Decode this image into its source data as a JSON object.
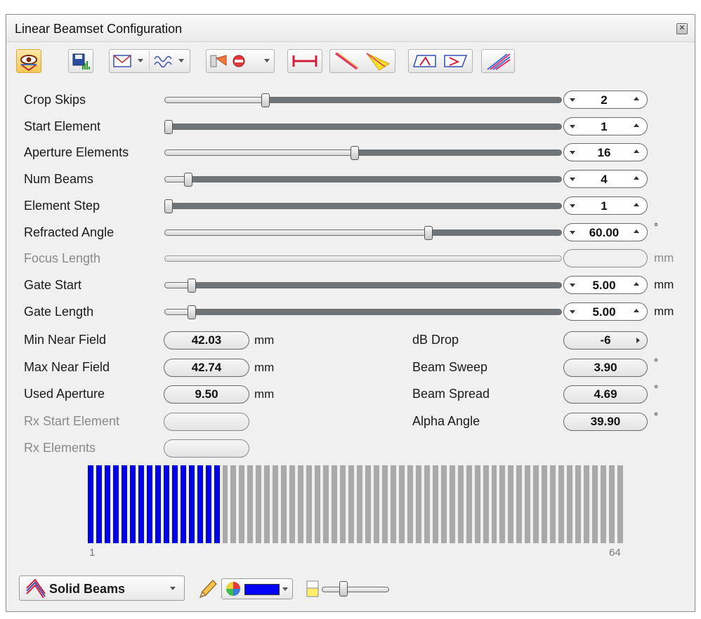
{
  "window": {
    "title": "Linear Beamset Configuration"
  },
  "toolbar": {
    "buttons": [
      {
        "icon": "eye-view-icon",
        "active": true
      },
      {
        "icon": "save-icon"
      },
      {
        "icon": "envelope-dropdown-icon"
      },
      {
        "icon": "waveform-dropdown-icon"
      },
      {
        "icon": "probe-stop-dropdown-icon"
      },
      {
        "icon": "width-measure-icon"
      },
      {
        "icon": "beam-direction-icon"
      },
      {
        "icon": "beam-fan-icon"
      },
      {
        "icon": "wedge-icon"
      },
      {
        "icon": "wedge-alt-icon"
      },
      {
        "icon": "striped-beam-icon"
      }
    ]
  },
  "sliders": [
    {
      "label": "Crop Skips",
      "value": "2",
      "level": 0.25,
      "disabled": false,
      "unit": ""
    },
    {
      "label": "Start Element",
      "value": "1",
      "level": 0.0,
      "disabled": false,
      "unit": ""
    },
    {
      "label": "Aperture Elements",
      "value": "16",
      "level": 0.48,
      "disabled": false,
      "unit": ""
    },
    {
      "label": "Num Beams",
      "value": "4",
      "level": 0.05,
      "disabled": false,
      "unit": ""
    },
    {
      "label": "Element Step",
      "value": "1",
      "level": 0.0,
      "disabled": false,
      "unit": ""
    },
    {
      "label": "Refracted Angle",
      "value": "60.00",
      "level": 0.67,
      "disabled": false,
      "unit": "°"
    },
    {
      "label": "Focus Length",
      "value": "",
      "level": null,
      "disabled": true,
      "unit": "mm"
    },
    {
      "label": "Gate Start",
      "value": "5.00",
      "level": 0.06,
      "disabled": false,
      "unit": "mm"
    },
    {
      "label": "Gate Length",
      "value": "5.00",
      "level": 0.06,
      "disabled": false,
      "unit": "mm"
    }
  ],
  "left_fields": [
    {
      "label": "Min Near Field",
      "value": "42.03",
      "unit": "mm",
      "disabled": false
    },
    {
      "label": "Max Near Field",
      "value": "42.74",
      "unit": "mm",
      "disabled": false
    },
    {
      "label": "Used Aperture",
      "value": "9.50",
      "unit": "mm",
      "disabled": false
    },
    {
      "label": "Rx Start Element",
      "value": "",
      "unit": "",
      "disabled": true
    },
    {
      "label": "Rx Elements",
      "value": "",
      "unit": "",
      "disabled": true
    }
  ],
  "right_fields": [
    {
      "label": "dB Drop",
      "value": "-6",
      "unit": "",
      "dropdown": true
    },
    {
      "label": "Beam Sweep",
      "value": "3.90",
      "unit": "°"
    },
    {
      "label": "Beam Spread",
      "value": "4.69",
      "unit": "°"
    },
    {
      "label": "Alpha Angle",
      "value": "39.90",
      "unit": "°"
    }
  ],
  "elements": {
    "total": 64,
    "active_count": 16,
    "start_label": "1",
    "end_label": "64",
    "active_color": "#0000e6",
    "inactive_color": "#a9a9a9"
  },
  "bottom": {
    "beam_mode": "Solid Beams",
    "beam_color": "#0000ff",
    "opacity_level": 0.3
  }
}
